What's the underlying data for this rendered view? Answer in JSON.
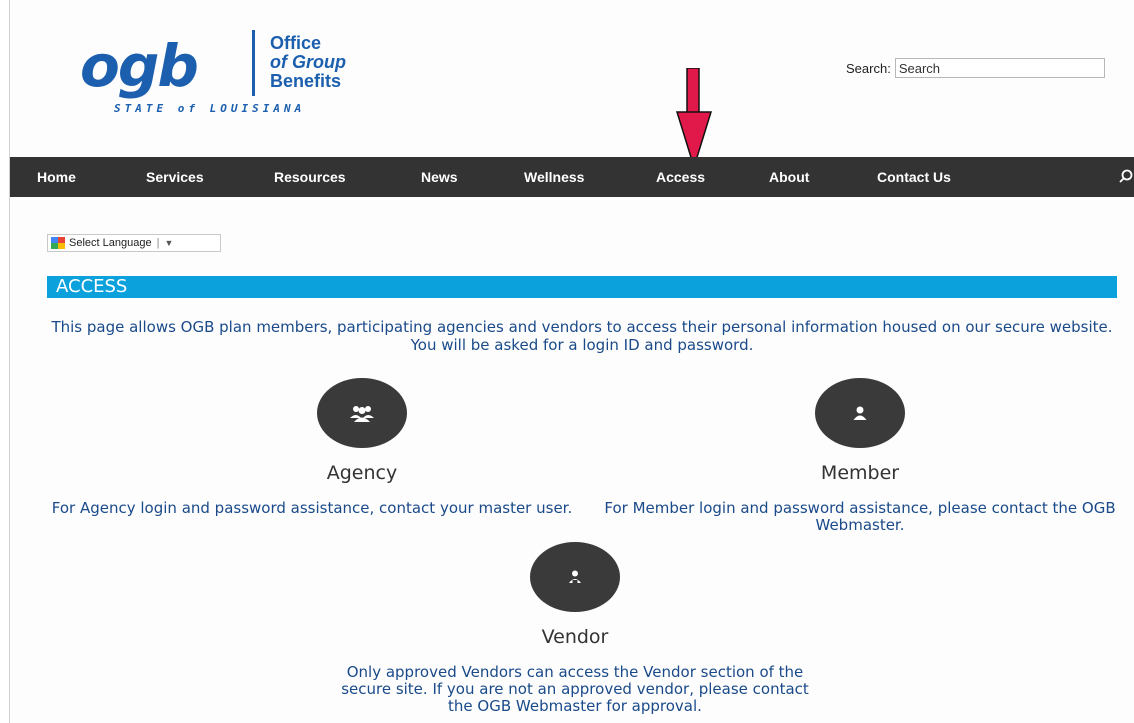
{
  "logo": {
    "mark": "ogb",
    "line1": "Office",
    "line2": "of Group",
    "line3": "Benefits",
    "tagline": "STATE of LOUISIANA"
  },
  "search": {
    "label": "Search:",
    "placeholder": "Search"
  },
  "nav": {
    "items": [
      "Home",
      "Services",
      "Resources",
      "News",
      "Wellness",
      "Access",
      "About",
      "Contact Us"
    ]
  },
  "translate": {
    "label": "Select Language"
  },
  "section": {
    "title": "ACCESS"
  },
  "intro": "This page allows OGB plan members, participating agencies and vendors to access their personal information housed on our secure website. You will be asked for a login ID and password.",
  "cards": [
    {
      "icon": "group-icon",
      "title": "Agency",
      "desc": "For Agency login and password assistance, contact your master user."
    },
    {
      "icon": "user-icon",
      "title": "Member",
      "desc": "For Member login and password assistance, please contact the OGB Webmaster."
    },
    {
      "icon": "vendor-icon",
      "title": "Vendor",
      "desc": "Only approved Vendors can access the Vendor section of the secure site. If you are not an approved vendor, please contact the OGB Webmaster for approval."
    }
  ],
  "colors": {
    "brand": "#1b5fae",
    "nav_bg": "#333333",
    "accent_bar": "#0ba1dc",
    "arrow": "#e0194a",
    "text_blue": "#1a4a8a"
  }
}
